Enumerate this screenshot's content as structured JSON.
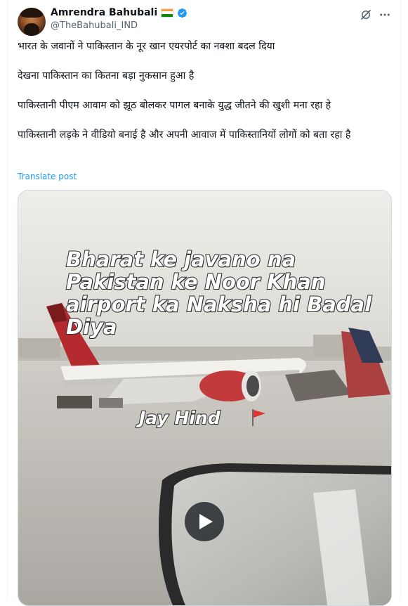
{
  "author": {
    "display_name": "Amrendra Bahubali",
    "handle": "@TheBahubali_IND",
    "flag_colors": [
      "#ff9933",
      "#ffffff",
      "#138808"
    ],
    "verified_color": "#1d9bf0"
  },
  "header_icons": [
    "grok-icon",
    "more-icon"
  ],
  "tweet": {
    "lines": [
      "भारत के जवानों ने पाकिस्तान के नूर खान एयरपोर्ट का नक्शा बदल दिया",
      "देखना पाकिस्तान का कितना बड़ा नुकसान हुआ है",
      "पाकिस्तानी पीएम आवाम को झूठ बोलकर पागल बनाके युद्ध जीतने की खुशी मना रहा हे",
      "पाकिस्तानी लड़के ने वीडियो बनाई है और अपनी आवाज में पाकिस्तानियों लोगों को बता रहा है"
    ],
    "translate_label": "Translate post"
  },
  "media": {
    "caption": "Bharat ke javano na Pakistan ke Noor Khan airport  ka Naksha hi Badal Diya",
    "overlay_text": "Jay Hind",
    "icons": [
      "red-flag-icon",
      "play-icon"
    ]
  }
}
